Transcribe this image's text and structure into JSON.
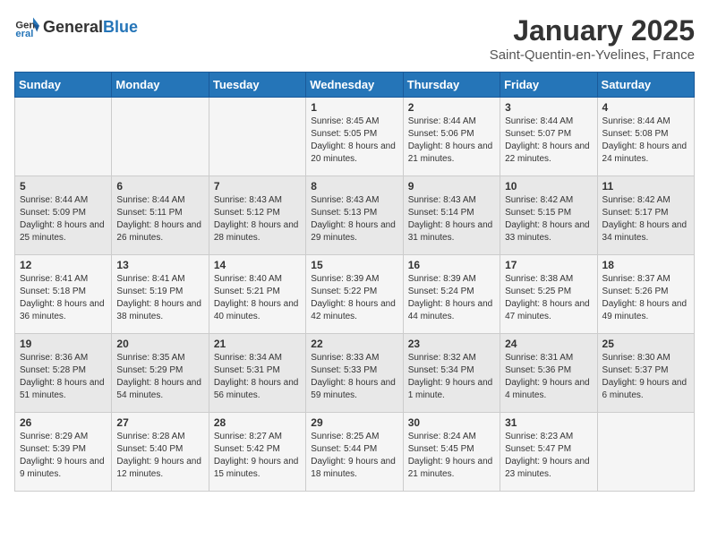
{
  "header": {
    "logo_general": "General",
    "logo_blue": "Blue",
    "title": "January 2025",
    "subtitle": "Saint-Quentin-en-Yvelines, France"
  },
  "weekdays": [
    "Sunday",
    "Monday",
    "Tuesday",
    "Wednesday",
    "Thursday",
    "Friday",
    "Saturday"
  ],
  "weeks": [
    [
      {
        "day": "",
        "info": ""
      },
      {
        "day": "",
        "info": ""
      },
      {
        "day": "",
        "info": ""
      },
      {
        "day": "1",
        "info": "Sunrise: 8:45 AM\nSunset: 5:05 PM\nDaylight: 8 hours and 20 minutes."
      },
      {
        "day": "2",
        "info": "Sunrise: 8:44 AM\nSunset: 5:06 PM\nDaylight: 8 hours and 21 minutes."
      },
      {
        "day": "3",
        "info": "Sunrise: 8:44 AM\nSunset: 5:07 PM\nDaylight: 8 hours and 22 minutes."
      },
      {
        "day": "4",
        "info": "Sunrise: 8:44 AM\nSunset: 5:08 PM\nDaylight: 8 hours and 24 minutes."
      }
    ],
    [
      {
        "day": "5",
        "info": "Sunrise: 8:44 AM\nSunset: 5:09 PM\nDaylight: 8 hours and 25 minutes."
      },
      {
        "day": "6",
        "info": "Sunrise: 8:44 AM\nSunset: 5:11 PM\nDaylight: 8 hours and 26 minutes."
      },
      {
        "day": "7",
        "info": "Sunrise: 8:43 AM\nSunset: 5:12 PM\nDaylight: 8 hours and 28 minutes."
      },
      {
        "day": "8",
        "info": "Sunrise: 8:43 AM\nSunset: 5:13 PM\nDaylight: 8 hours and 29 minutes."
      },
      {
        "day": "9",
        "info": "Sunrise: 8:43 AM\nSunset: 5:14 PM\nDaylight: 8 hours and 31 minutes."
      },
      {
        "day": "10",
        "info": "Sunrise: 8:42 AM\nSunset: 5:15 PM\nDaylight: 8 hours and 33 minutes."
      },
      {
        "day": "11",
        "info": "Sunrise: 8:42 AM\nSunset: 5:17 PM\nDaylight: 8 hours and 34 minutes."
      }
    ],
    [
      {
        "day": "12",
        "info": "Sunrise: 8:41 AM\nSunset: 5:18 PM\nDaylight: 8 hours and 36 minutes."
      },
      {
        "day": "13",
        "info": "Sunrise: 8:41 AM\nSunset: 5:19 PM\nDaylight: 8 hours and 38 minutes."
      },
      {
        "day": "14",
        "info": "Sunrise: 8:40 AM\nSunset: 5:21 PM\nDaylight: 8 hours and 40 minutes."
      },
      {
        "day": "15",
        "info": "Sunrise: 8:39 AM\nSunset: 5:22 PM\nDaylight: 8 hours and 42 minutes."
      },
      {
        "day": "16",
        "info": "Sunrise: 8:39 AM\nSunset: 5:24 PM\nDaylight: 8 hours and 44 minutes."
      },
      {
        "day": "17",
        "info": "Sunrise: 8:38 AM\nSunset: 5:25 PM\nDaylight: 8 hours and 47 minutes."
      },
      {
        "day": "18",
        "info": "Sunrise: 8:37 AM\nSunset: 5:26 PM\nDaylight: 8 hours and 49 minutes."
      }
    ],
    [
      {
        "day": "19",
        "info": "Sunrise: 8:36 AM\nSunset: 5:28 PM\nDaylight: 8 hours and 51 minutes."
      },
      {
        "day": "20",
        "info": "Sunrise: 8:35 AM\nSunset: 5:29 PM\nDaylight: 8 hours and 54 minutes."
      },
      {
        "day": "21",
        "info": "Sunrise: 8:34 AM\nSunset: 5:31 PM\nDaylight: 8 hours and 56 minutes."
      },
      {
        "day": "22",
        "info": "Sunrise: 8:33 AM\nSunset: 5:33 PM\nDaylight: 8 hours and 59 minutes."
      },
      {
        "day": "23",
        "info": "Sunrise: 8:32 AM\nSunset: 5:34 PM\nDaylight: 9 hours and 1 minute."
      },
      {
        "day": "24",
        "info": "Sunrise: 8:31 AM\nSunset: 5:36 PM\nDaylight: 9 hours and 4 minutes."
      },
      {
        "day": "25",
        "info": "Sunrise: 8:30 AM\nSunset: 5:37 PM\nDaylight: 9 hours and 6 minutes."
      }
    ],
    [
      {
        "day": "26",
        "info": "Sunrise: 8:29 AM\nSunset: 5:39 PM\nDaylight: 9 hours and 9 minutes."
      },
      {
        "day": "27",
        "info": "Sunrise: 8:28 AM\nSunset: 5:40 PM\nDaylight: 9 hours and 12 minutes."
      },
      {
        "day": "28",
        "info": "Sunrise: 8:27 AM\nSunset: 5:42 PM\nDaylight: 9 hours and 15 minutes."
      },
      {
        "day": "29",
        "info": "Sunrise: 8:25 AM\nSunset: 5:44 PM\nDaylight: 9 hours and 18 minutes."
      },
      {
        "day": "30",
        "info": "Sunrise: 8:24 AM\nSunset: 5:45 PM\nDaylight: 9 hours and 21 minutes."
      },
      {
        "day": "31",
        "info": "Sunrise: 8:23 AM\nSunset: 5:47 PM\nDaylight: 9 hours and 23 minutes."
      },
      {
        "day": "",
        "info": ""
      }
    ]
  ]
}
